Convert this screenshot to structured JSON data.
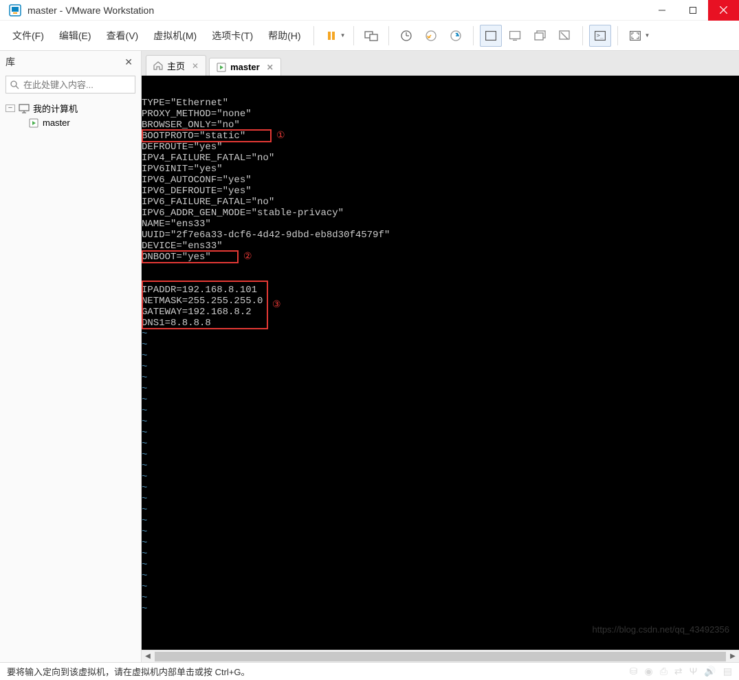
{
  "window": {
    "title": "master - VMware Workstation"
  },
  "menu": {
    "file": "文件(F)",
    "edit": "编辑(E)",
    "view": "查看(V)",
    "vm": "虚拟机(M)",
    "tabs": "选项卡(T)",
    "help": "帮助(H)"
  },
  "sidebar": {
    "title": "库",
    "search_placeholder": "在此处键入内容...",
    "root": "我的计算机",
    "items": [
      {
        "label": "master"
      }
    ]
  },
  "tabs": {
    "home": "主页",
    "vm": "master"
  },
  "terminal": {
    "lines": [
      "TYPE=\"Ethernet\"",
      "PROXY_METHOD=\"none\"",
      "BROWSER_ONLY=\"no\"",
      "BOOTPROTO=\"static\"",
      "DEFROUTE=\"yes\"",
      "IPV4_FAILURE_FATAL=\"no\"",
      "IPV6INIT=\"yes\"",
      "IPV6_AUTOCONF=\"yes\"",
      "IPV6_DEFROUTE=\"yes\"",
      "IPV6_FAILURE_FATAL=\"no\"",
      "IPV6_ADDR_GEN_MODE=\"stable-privacy\"",
      "NAME=\"ens33\"",
      "UUID=\"2f7e6a33-dcf6-4d42-9dbd-eb8d30f4579f\"",
      "DEVICE=\"ens33\"",
      "ONBOOT=\"yes\"",
      "",
      "",
      "IPADDR=192.168.8.101",
      "NETMASK=255.255.255.0",
      "GATEWAY=192.168.8.2",
      "DNS1=8.8.8.8"
    ],
    "annotations": {
      "label1": "①",
      "label2": "②",
      "label3": "③"
    }
  },
  "status": {
    "message": "要将输入定向到该虚拟机，请在虚拟机内部单击或按 Ctrl+G。"
  },
  "watermark": "https://blog.csdn.net/qq_43492356"
}
